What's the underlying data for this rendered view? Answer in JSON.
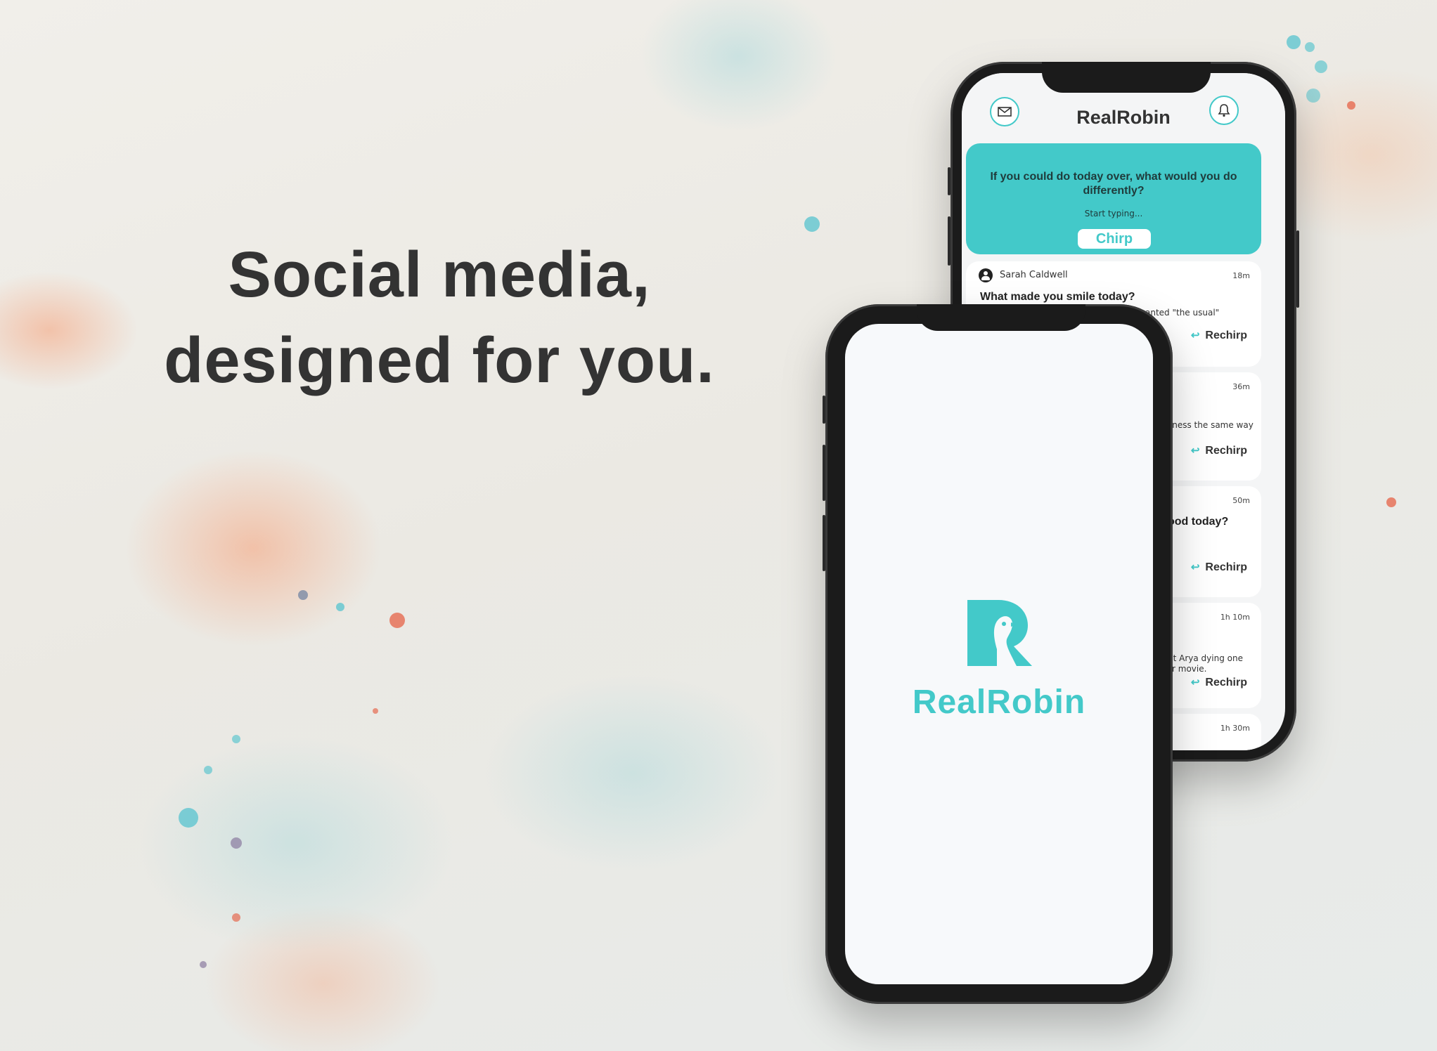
{
  "headline": {
    "line1": "Social media,",
    "line2": "designed for you."
  },
  "colors": {
    "accent": "#43c9c9",
    "text_dark": "#333333",
    "phone_frame": "#1b1b1b"
  },
  "back_phone": {
    "app_title": "RealRobin",
    "icons": {
      "left": "mail-icon",
      "right": "bell-icon"
    },
    "prompt_card": {
      "question": "If you could do today over, what would you do differently?",
      "placeholder": "Start typing...",
      "button_label": "Chirp"
    },
    "posts": [
      {
        "author": "Sarah Caldwell",
        "time": "18m",
        "question": "What made you smile today?",
        "snippet": "anted \"the usual\"",
        "action": "Rechirp"
      },
      {
        "time": "36m",
        "snippet": "sness the same way",
        "action": "Rechirp"
      },
      {
        "time": "50m",
        "question": "ood today?",
        "action": "Rechirp"
      },
      {
        "time": "1h 10m",
        "snippet_line1": "ut Arya dying one",
        "snippet_line2": "r movie.",
        "action": "Rechirp"
      },
      {
        "time": "1h 30m"
      }
    ]
  },
  "front_phone": {
    "logo_icon": "robin-r-logo-icon",
    "logo_text": "RealRobin"
  }
}
